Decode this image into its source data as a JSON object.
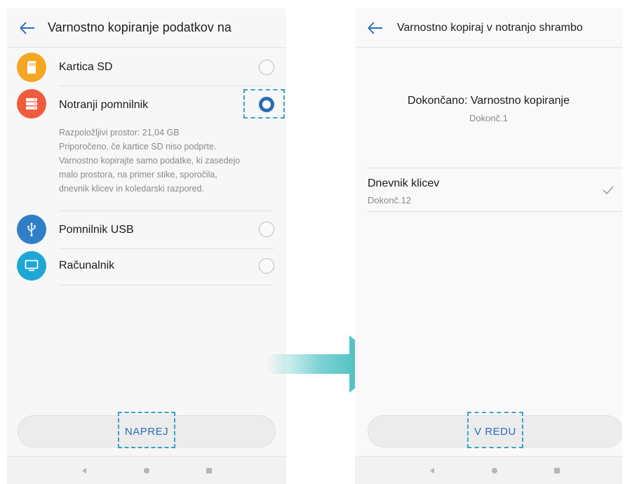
{
  "left_screen": {
    "title": "Varnostno kopiranje podatkov na",
    "options": [
      {
        "label": "Kartica SD",
        "icon": "sd-card-icon",
        "color": "#f5a623",
        "selected": false
      },
      {
        "label": "Notranji pomnilnik",
        "icon": "storage-icon",
        "color": "#ef5b3c",
        "selected": true
      },
      {
        "label": "Pomnilnik USB",
        "icon": "usb-icon",
        "color": "#2f7fc8",
        "selected": false
      },
      {
        "label": "Računalnik",
        "icon": "computer-icon",
        "color": "#1ea7d6",
        "selected": false
      }
    ],
    "storage_info": "Razpoložljivi prostor: 21,04 GB",
    "storage_description": "Priporočeno, če kartice SD niso podprte. Varnostno kopirajte samo podatke, ki zasedejo malo prostora, na primer stike, sporočila, dnevnik klicev in koledarski razpored.",
    "next_button": "NAPREJ"
  },
  "right_screen": {
    "title": "Varnostno kopiraj v notranjo shrambo",
    "status_title": "Dokončano: Varnostno kopiranje",
    "status_sub": "Dokonč.1",
    "result_title": "Dnevnik klicev",
    "result_sub": "Dokonč.12",
    "ok_button": "V REDU"
  },
  "colors": {
    "accent": "#2a6db5",
    "highlight": "#3aa3c2",
    "arrow": "#2bb5b8"
  }
}
